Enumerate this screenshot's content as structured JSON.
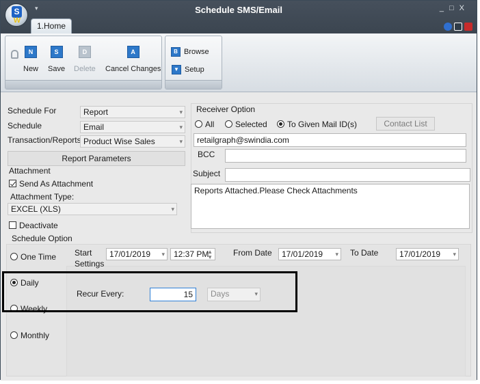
{
  "window": {
    "title": "Schedule SMS/Email",
    "tab": "1.Home"
  },
  "ribbon": {
    "new": "New",
    "save": "Save",
    "delete": "Delete",
    "cancel": "Cancel Changes",
    "browse": "Browse",
    "setup": "Setup",
    "icons": {
      "new": "N",
      "save": "S",
      "delete": "D",
      "cancel": "A",
      "browse": "B"
    }
  },
  "left": {
    "schedule_for_label": "Schedule For",
    "schedule_for_value": "Report",
    "schedule_label": "Schedule",
    "schedule_value": "Email",
    "transaction_label": "Transaction/Reports",
    "transaction_value": "Product Wise Sales",
    "report_params": "Report Parameters",
    "attachment_label": "Attachment",
    "send_as_attachment": "Send As Attachment",
    "attachment_type_label": "Attachment Type:",
    "attachment_type_value": "EXCEL (XLS)",
    "deactivate": "Deactivate"
  },
  "receiver": {
    "label": "Receiver Option",
    "all": "All",
    "selected": "Selected",
    "given": "To Given Mail ID(s)",
    "contact_list": "Contact List",
    "email": "retailgraph@swindia.com",
    "bcc_label": "BCC",
    "bcc": "",
    "subject_label": "Subject",
    "subject": "",
    "body": "Reports Attached.Please Check Attachments"
  },
  "schedule_option": {
    "label": "Schedule Option",
    "one_time": "One Time",
    "daily": "Daily",
    "weekly": "Weekly",
    "monthly": "Monthly",
    "start_label": "Start",
    "settings_label": "Settings",
    "start_date": "17/01/2019",
    "start_time": "12:37 PM",
    "from_label": "From Date",
    "from_date": "17/01/2019",
    "to_label": "To Date",
    "to_date": "17/01/2019",
    "recur_label": "Recur Every:",
    "recur_value": "15",
    "recur_unit": "Days"
  }
}
